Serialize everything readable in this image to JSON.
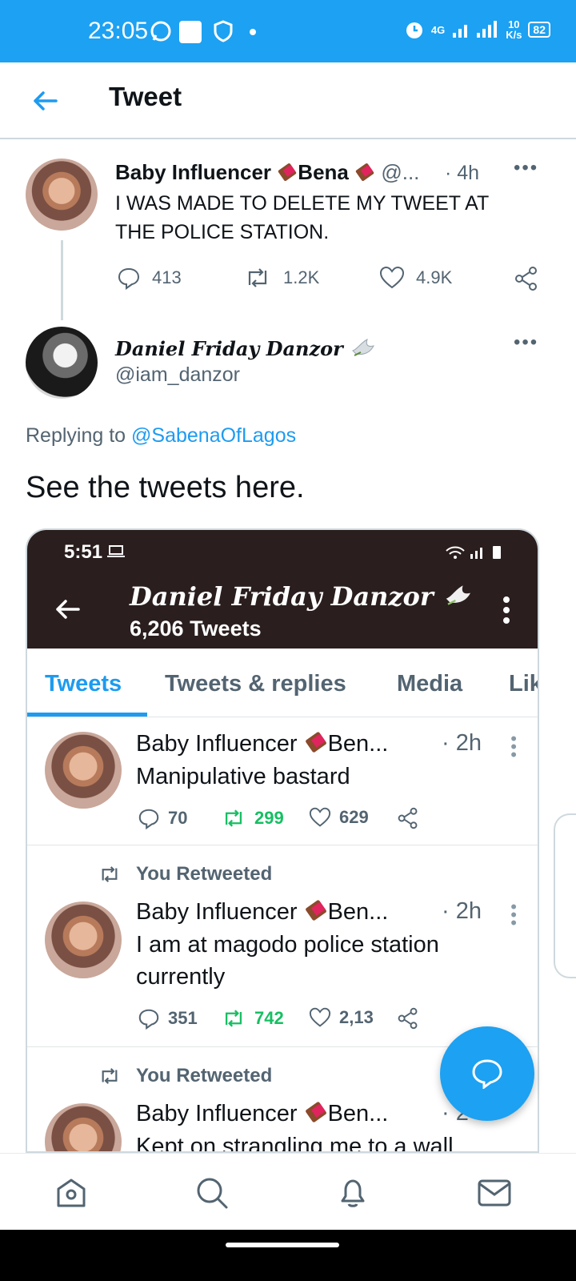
{
  "status_bar": {
    "time": "23:05",
    "network": "4G",
    "speed_value": "10",
    "speed_unit": "K/s",
    "battery": "82"
  },
  "header": {
    "title": "Tweet"
  },
  "main_tweet": {
    "name_part1": "Baby Influencer",
    "name_part2": "Bena",
    "handle": "@...",
    "time": "· 4h",
    "text_line1": "I WAS MADE TO DELETE MY TWEET AT",
    "text_line2": "THE POLICE STATION.",
    "replies": "413",
    "retweets": "1.2K",
    "likes": "4.9K"
  },
  "reply_tweet": {
    "name": "Daniel Friday Danzor",
    "handle": "@iam_danzor",
    "replying_prefix": "Replying to ",
    "replying_to": "@SabenaOfLagos",
    "text": "See the tweets here."
  },
  "embedded": {
    "time": "5:51",
    "profile_name": "Daniel Friday Danzor",
    "tweet_count": "6,206 Tweets",
    "tabs": [
      "Tweets",
      "Tweets & replies",
      "Media",
      "Lik"
    ],
    "tweets": [
      {
        "name": "Baby Influencer",
        "name_suffix": "Ben...",
        "time": "· 2h",
        "text_line1": "Manipulative bastard",
        "text_line2": "",
        "replies": "70",
        "retweets": "299",
        "likes": "629",
        "retweet_label": ""
      },
      {
        "name": "Baby Influencer",
        "name_suffix": "Ben...",
        "time": "· 2h",
        "text_line1": "I am at magodo  police station",
        "text_line2": "currently",
        "replies": "351",
        "retweets": "742",
        "likes": "2,13",
        "retweet_label": "You Retweeted"
      },
      {
        "name": "Baby Influencer",
        "name_suffix": "Ben...",
        "time": "· 2",
        "text_line1": "Kept on strangling me to a wall",
        "retweet_label": "You Retweeted"
      }
    ]
  },
  "colors": {
    "twitter_blue": "#1da1f2",
    "link_blue": "#1d9bf0",
    "retweet_green": "#17bf63",
    "muted_gray": "#536471",
    "embed_header": "#2a1e1e"
  },
  "icons": [
    "back-arrow-icon",
    "reply-icon",
    "retweet-icon",
    "like-icon",
    "share-icon",
    "more-icon",
    "home-icon",
    "search-icon",
    "notifications-icon",
    "messages-icon",
    "compose-icon"
  ]
}
